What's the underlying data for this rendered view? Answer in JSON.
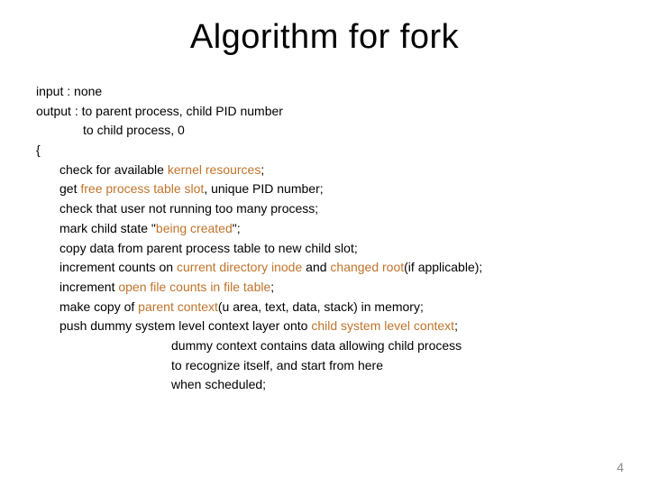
{
  "title": "Algorithm for fork",
  "lines": {
    "input": "input : none",
    "output1": "output : to parent process, child PID number",
    "output2": "to child process, 0",
    "brace": "{",
    "l1a": "check for available ",
    "l1b": "kernel resources",
    "l1c": ";",
    "l2a": "get ",
    "l2b": "free process table slot",
    "l2c": ", unique PID number;",
    "l3": "check that user not running too many process;",
    "l4a": "mark child state \"",
    "l4b": "being created",
    "l4c": "\";",
    "l5": "copy data from parent process table to new child slot;",
    "l6a": "increment counts on ",
    "l6b": "current directory inode",
    "l6c": " and ",
    "l6d": "changed root",
    "l6e": "(if applicable);",
    "l7a": "increment ",
    "l7b": "open file counts in file table",
    "l7c": ";",
    "l8a": "make copy of ",
    "l8b": "parent context",
    "l8c": "(u area, text, data, stack) in memory;",
    "l9a": "push dummy system level context layer onto ",
    "l9b": "child system level context",
    "l9c": ";",
    "l10": "dummy context contains data allowing child process",
    "l11": "to recognize itself, and start from here",
    "l12": "when scheduled;"
  },
  "page": "4"
}
